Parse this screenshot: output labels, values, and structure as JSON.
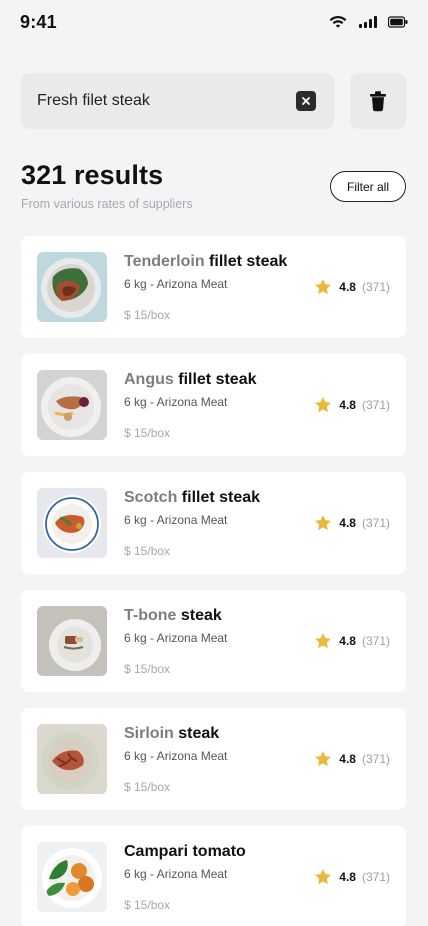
{
  "status_bar": {
    "time": "9:41",
    "wifi_icon": "wifi-icon",
    "signal_icon": "signal-icon",
    "battery_icon": "battery-icon"
  },
  "search": {
    "query": "Fresh filet steak",
    "clear_icon": "close-icon",
    "trash_icon": "trash-icon"
  },
  "results": {
    "title": "321 results",
    "subtitle": "From various rates of suppliers",
    "filter_label": "Filter all"
  },
  "colors": {
    "background": "#f3f4f6",
    "card": "#ffffff",
    "star": "#e8b93a",
    "muted_text": "#a6a8ad"
  },
  "products": [
    {
      "name_prefix": "Tenderloin",
      "name_main": "fillet steak",
      "meta": "6 kg - Arizona Meat",
      "price": "$ 15/box",
      "rating": "4.8",
      "rating_count": "(371)",
      "image_icon": "tenderloin-steak-plate-image"
    },
    {
      "name_prefix": "Angus",
      "name_main": "fillet steak",
      "meta": "6 kg - Arizona Meat",
      "price": "$ 15/box",
      "rating": "4.8",
      "rating_count": "(371)",
      "image_icon": "angus-steak-plate-image"
    },
    {
      "name_prefix": "Scotch",
      "name_main": "fillet steak",
      "meta": "6 kg - Arizona Meat",
      "price": "$ 15/box",
      "rating": "4.8",
      "rating_count": "(371)",
      "image_icon": "scotch-steak-plate-image"
    },
    {
      "name_prefix": "T-bone",
      "name_main": "steak",
      "meta": "6 kg - Arizona Meat",
      "price": "$ 15/box",
      "rating": "4.8",
      "rating_count": "(371)",
      "image_icon": "tbone-steak-plate-image"
    },
    {
      "name_prefix": "Sirloin",
      "name_main": "steak",
      "meta": "6 kg - Arizona Meat",
      "price": "$ 15/box",
      "rating": "4.8",
      "rating_count": "(371)",
      "image_icon": "sirloin-steak-plate-image"
    },
    {
      "name_prefix": "",
      "name_main": "Campari tomato",
      "meta": "6 kg - Arizona Meat",
      "price": "$ 15/box",
      "rating": "4.8",
      "rating_count": "(371)",
      "image_icon": "tomato-plate-image"
    }
  ]
}
